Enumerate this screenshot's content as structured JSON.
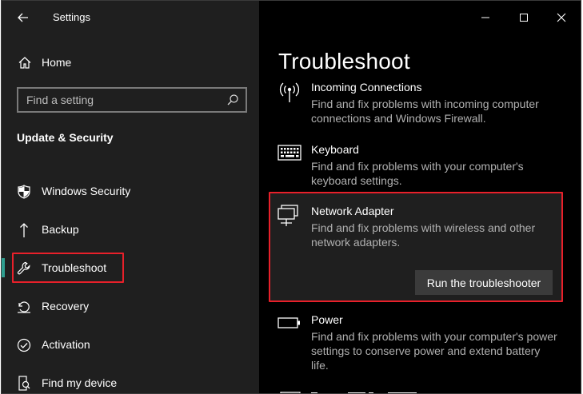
{
  "window": {
    "title": "Settings"
  },
  "sidebar": {
    "home_label": "Home",
    "search_placeholder": "Find a setting",
    "section_title": "Update & Security",
    "items": [
      {
        "label": "Windows Security",
        "icon": "shield-icon"
      },
      {
        "label": "Backup",
        "icon": "backup-arrow-icon"
      },
      {
        "label": "Troubleshoot",
        "icon": "wrench-icon",
        "selected": true
      },
      {
        "label": "Recovery",
        "icon": "recovery-icon"
      },
      {
        "label": "Activation",
        "icon": "activation-check-icon"
      },
      {
        "label": "Find my device",
        "icon": "find-device-icon"
      }
    ]
  },
  "main": {
    "title": "Troubleshoot",
    "items": [
      {
        "name": "Incoming Connections",
        "description": "Find and fix problems with incoming computer connections and Windows Firewall.",
        "icon": "antenna-icon"
      },
      {
        "name": "Keyboard",
        "description": "Find and fix problems with your computer's keyboard settings.",
        "icon": "keyboard-icon"
      },
      {
        "name": "Network Adapter",
        "description": "Find and fix problems with wireless and other network adapters.",
        "icon": "network-adapter-icon",
        "expanded": true,
        "button_label": "Run the troubleshooter"
      },
      {
        "name": "Power",
        "description": "Find and fix problems with your computer's power settings to conserve power and extend battery life.",
        "icon": "battery-icon"
      }
    ]
  },
  "colors": {
    "accent": "#2e9e8f",
    "highlight": "#e8202a",
    "background": "#000000",
    "sidebar": "#1f1f1f"
  }
}
